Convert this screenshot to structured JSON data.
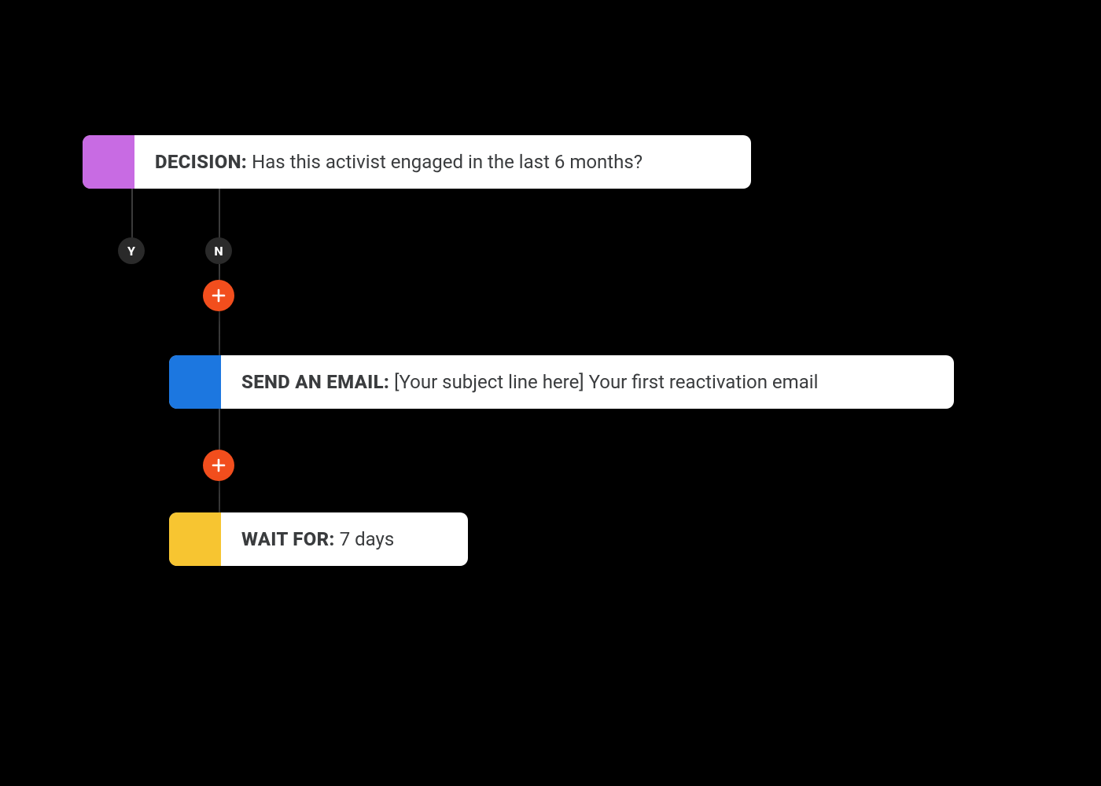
{
  "colors": {
    "decision": "#C86BE3",
    "email": "#1C77E0",
    "wait": "#F7C531",
    "add": "#F24E1D",
    "badge": "#2A2A2A"
  },
  "flow": {
    "decision": {
      "label": "DECISION:",
      "value": "Has this activist engaged in the last 6 months?"
    },
    "branches": {
      "yes": "Y",
      "no": "N"
    },
    "email": {
      "label": "SEND AN EMAIL:",
      "value": "[Your subject line here] Your first reactivation email"
    },
    "wait": {
      "label": "WAIT FOR:",
      "value": "7 days"
    }
  }
}
